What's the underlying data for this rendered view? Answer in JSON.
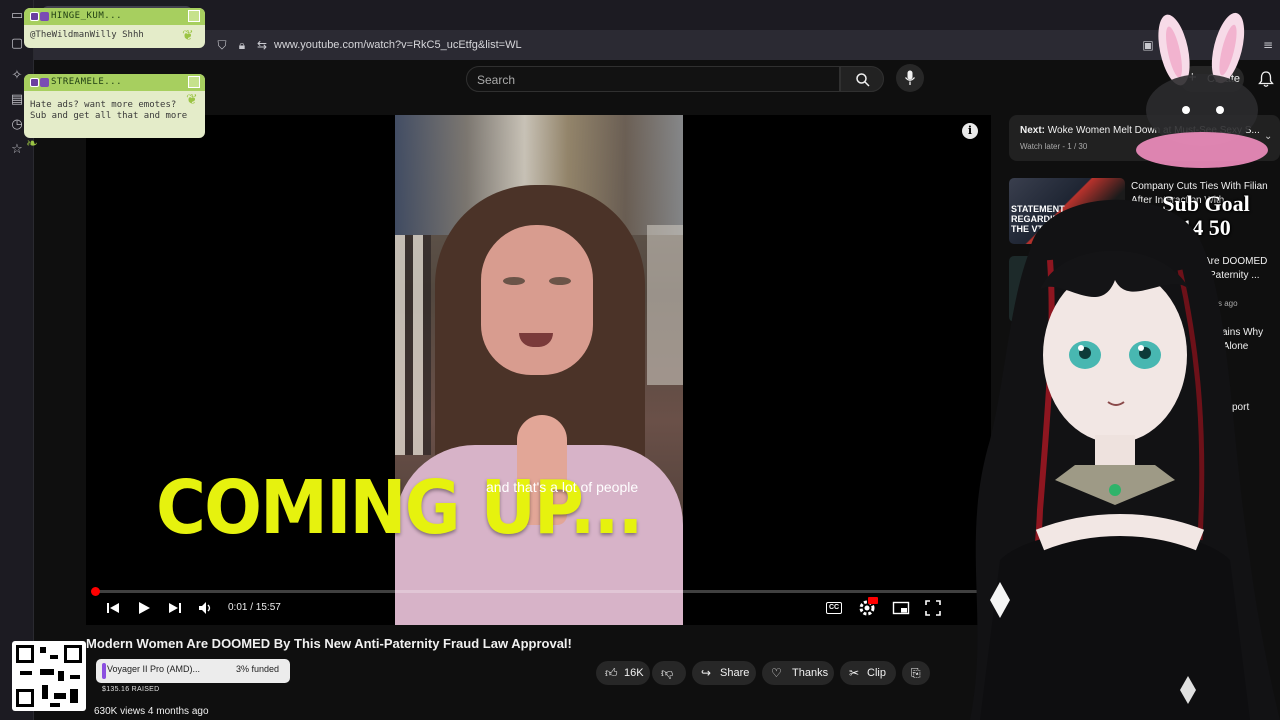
{
  "browser": {
    "url": "www.youtube.com/watch?v=RkC5_ucEtfg&list=WL"
  },
  "header": {
    "search_placeholder": "Search",
    "create_label": "Create"
  },
  "video": {
    "overlay_text": "COMING UP...",
    "caption": "and that's a lot of people",
    "time": "0:01 / 15:57",
    "progress_fraction": 0.001,
    "cc_label": "CC"
  },
  "below_video": {
    "title": "Modern Women Are DOOMED By This New Anti-Paternity Fraud Law Approval!",
    "likes": "16K",
    "share": "Share",
    "thanks": "Thanks",
    "clip": "Clip",
    "views": "630K views  4 months ago"
  },
  "up_next": {
    "next_label": "Next:",
    "next_title": "Woke Women Melt Down at Must-See Sexy S...",
    "watch_later": "Watch later - 1 / 30"
  },
  "recommendations": [
    {
      "title_1": "Company Cuts Ties With Filian",
      "title_2": "After Interaction With",
      "thumb_text": "STATEMENT REGARDING THE VTA"
    },
    {
      "title_1": "Are DOOMED",
      "title_2": "Paternity ...",
      "meta": "s ago"
    },
    {
      "title_1": "ains Why",
      "title_2": "d Alone"
    },
    {
      "title_1": "port"
    }
  ],
  "stream_overlay": {
    "chat": [
      {
        "user": "HINGE_KUM...",
        "message": "@TheWildmanWilly Shhh"
      },
      {
        "user": "STREAMELE...",
        "message_1": "Hate ads? want more emotes?",
        "message_2": "Sub and get all that and more"
      }
    ],
    "sub_goal": {
      "title": "Sub Goal",
      "count": "14  50"
    },
    "funding": {
      "item": "Voyager II Pro (AMD)...",
      "percent": "3% funded",
      "raised": "$135.16 RAISED"
    }
  },
  "colors": {
    "accent_red": "#ff0000",
    "overlay_yellow": "#e6f20e",
    "chat_green": "#a7cf5f"
  }
}
